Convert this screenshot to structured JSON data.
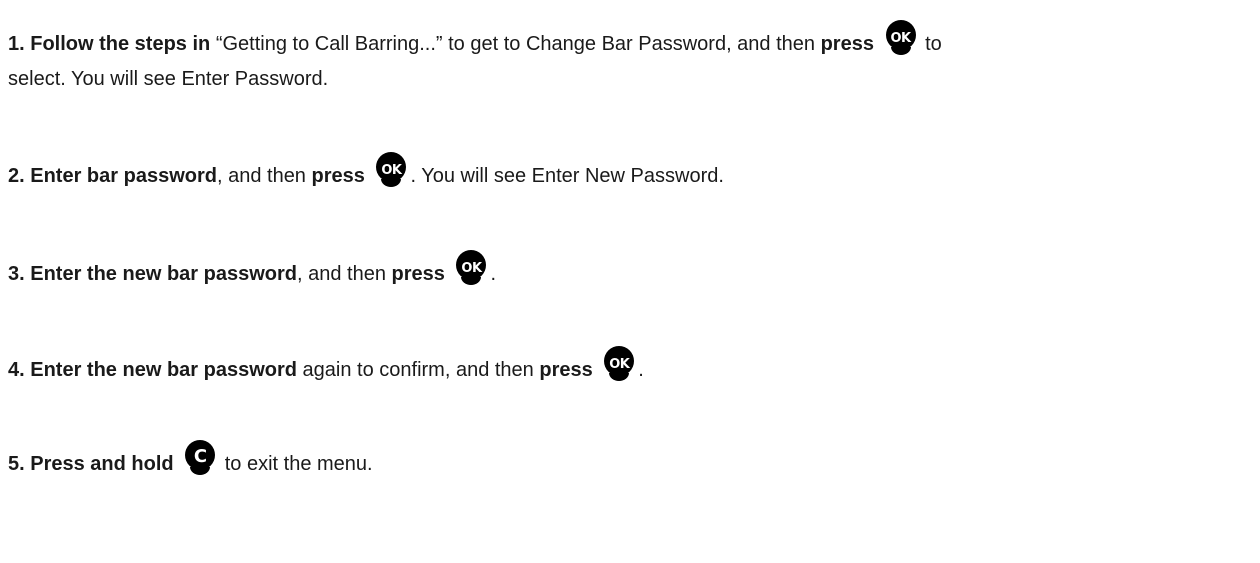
{
  "steps": [
    {
      "number": "1.",
      "bold_lead": "Follow the steps in",
      "text_a": " “Getting to Call Barring...” to get to Change Bar Password, and then ",
      "bold_press": "press",
      "key": "OK",
      "text_b": " to",
      "line2": "select. You will see Enter Password."
    },
    {
      "number": "2.",
      "bold_lead": "Enter bar password",
      "text_a": ", and then ",
      "bold_press": "press",
      "key": "OK",
      "text_b": ". You will see Enter New Password."
    },
    {
      "number": "3.",
      "bold_lead": "Enter the new bar password",
      "text_a": ", and then ",
      "bold_press": "press",
      "key": "OK",
      "text_b": "."
    },
    {
      "number": "4.",
      "bold_lead": "Enter the new bar password",
      "text_a": " again to confirm, and then ",
      "bold_press": "press",
      "key": "OK",
      "text_b": "."
    },
    {
      "number": "5.",
      "bold_lead": "Press and hold",
      "key": "C",
      "text_b": " to exit the menu."
    }
  ],
  "colors": {
    "text": "#1a1a1a",
    "key_background": "#000000",
    "key_glyph": "#ffffff"
  },
  "icons": {
    "ok_key": "ok-button-icon",
    "c_key": "clear-button-icon"
  }
}
